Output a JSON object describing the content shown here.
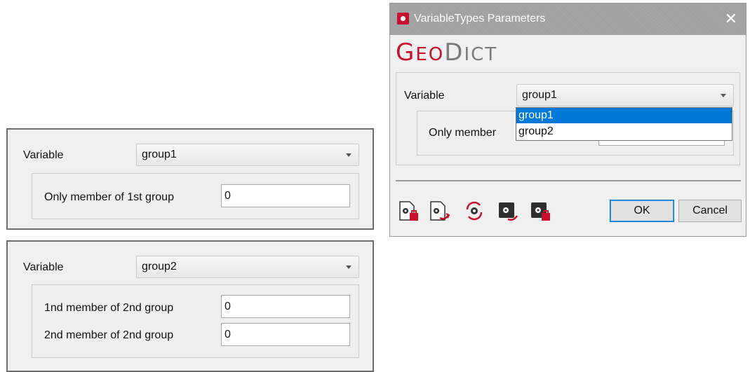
{
  "panel1": {
    "variable_label": "Variable",
    "variable_value": "group1",
    "field_label": "Only member of 1st group",
    "field_value": "0"
  },
  "panel2": {
    "variable_label": "Variable",
    "variable_value": "group2",
    "fields": [
      {
        "label": "1nd member of 2nd group",
        "value": "0"
      },
      {
        "label": "2nd member of 2nd group",
        "value": "0"
      }
    ]
  },
  "dialog": {
    "title": "VariableTypes Parameters",
    "close": "✕",
    "logo_geo": [
      "G",
      "EO"
    ],
    "logo_dict": [
      "D",
      "ICT"
    ],
    "variable_label": "Variable",
    "variable_value": "group1",
    "partial_label": "Only member",
    "dropdown_options": [
      "group1",
      "group2"
    ],
    "dropdown_selected": "group1",
    "toolbar_icons": [
      "load-parameters-icon",
      "save-parameters-icon",
      "reset-parameters-icon",
      "load-macro-icon",
      "save-macro-icon"
    ],
    "ok_label": "OK",
    "cancel_label": "Cancel"
  },
  "colors": {
    "accent": "#c8102e",
    "selection": "#0078d7",
    "titlebar": "#a2a2a2"
  }
}
